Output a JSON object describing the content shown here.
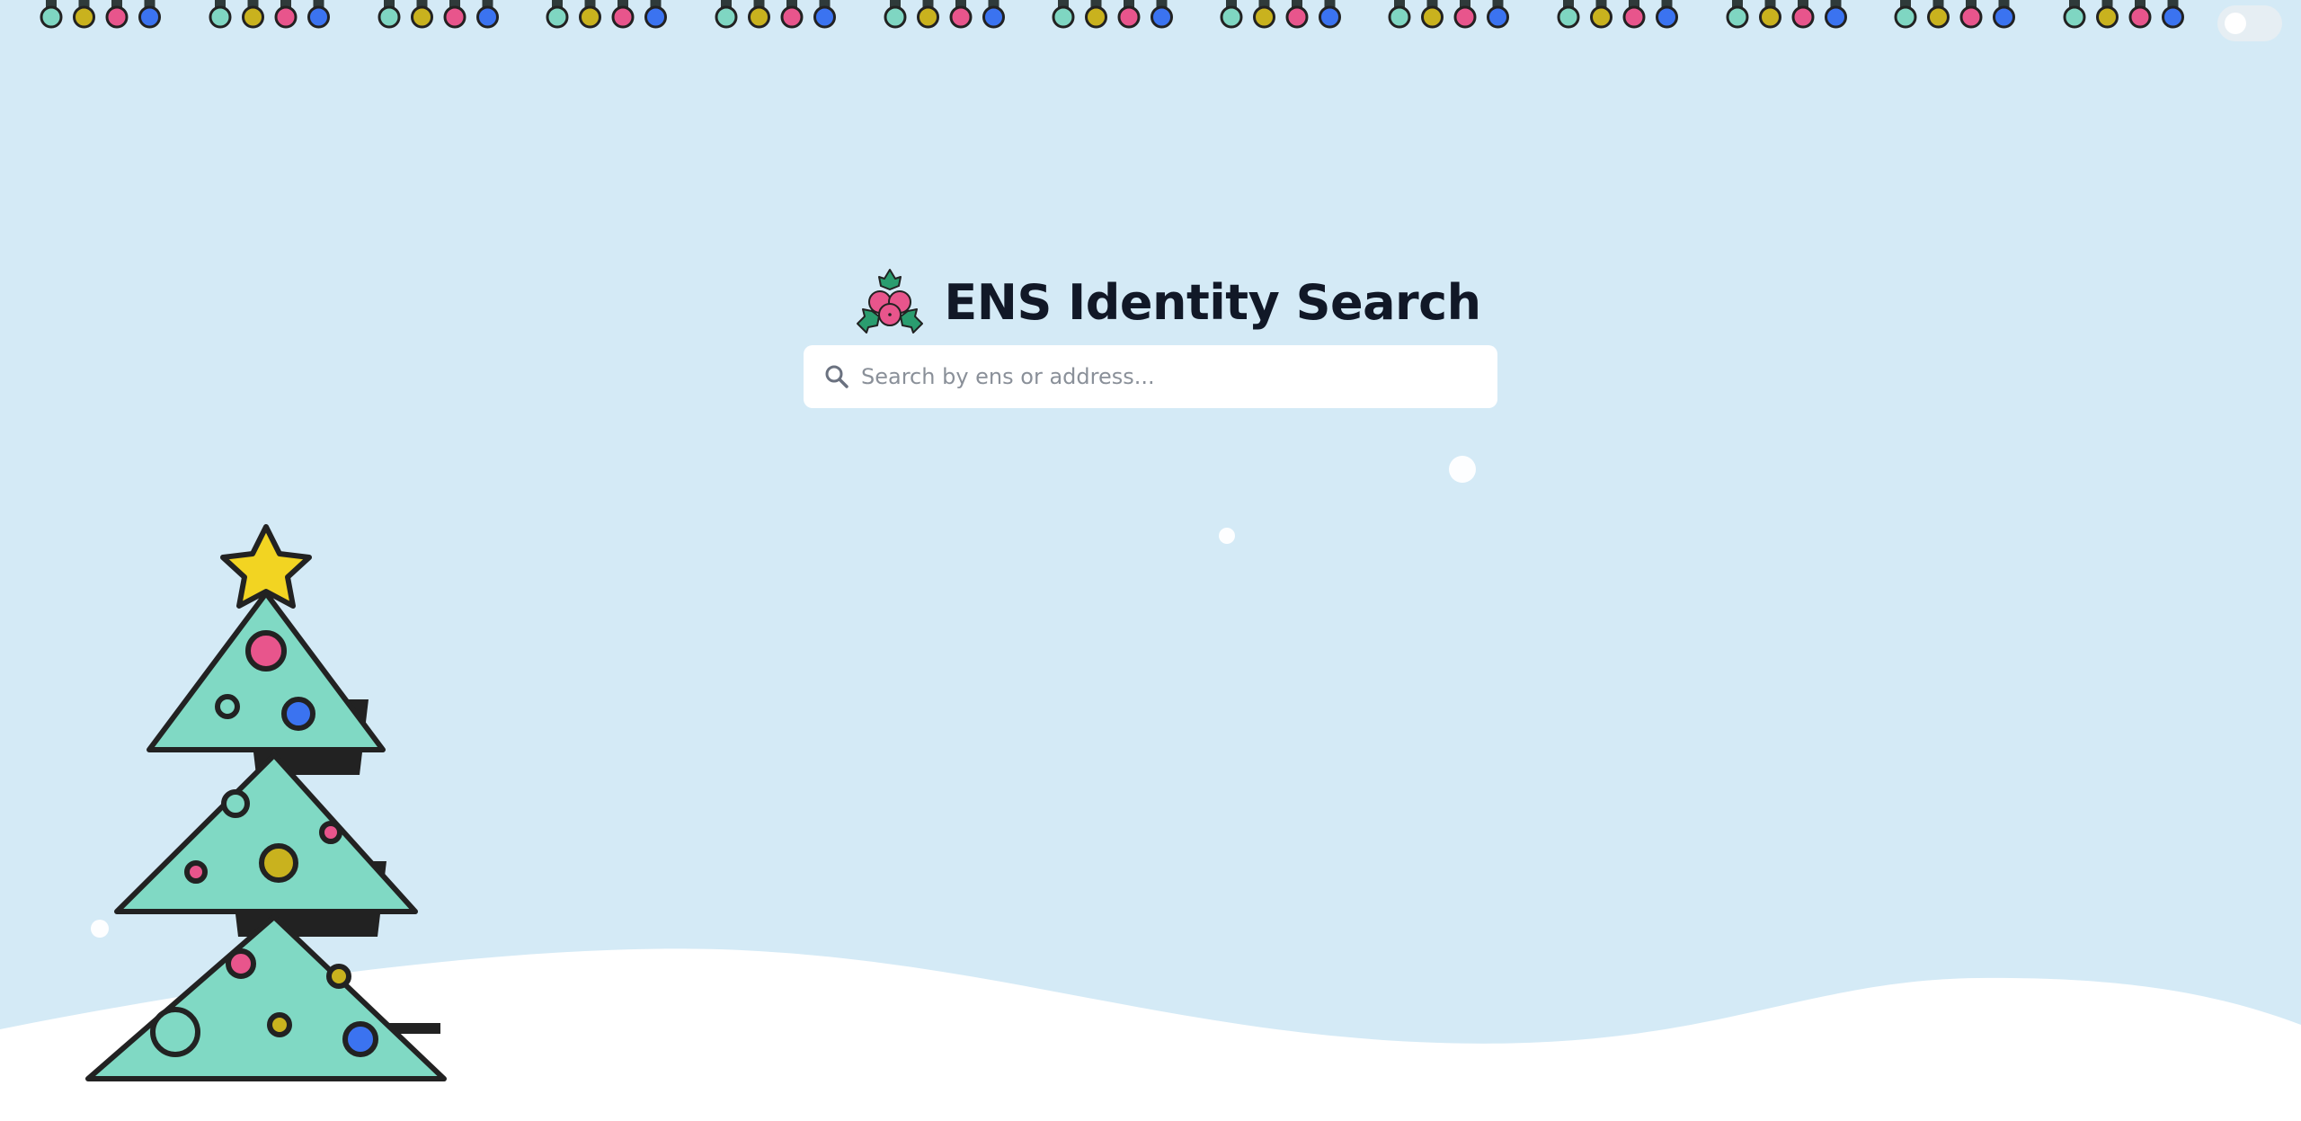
{
  "app": {
    "title": "ENS Identity Search"
  },
  "search": {
    "placeholder": "Search by ens or address...",
    "value": ""
  },
  "theme_toggle": {
    "state": "off"
  },
  "colors": {
    "background": "#d4eaf6",
    "snow": "#ffffff",
    "bulb_teal": "#7fd6c2",
    "bulb_yellow": "#c9b21e",
    "bulb_pink": "#e8558c",
    "bulb_blue": "#3b73f0",
    "tree_green": "#80d9c4",
    "star_yellow": "#f2d422",
    "holly_leaf": "#2a9d6f",
    "outline": "#222222"
  },
  "icons": {
    "search": "search-icon",
    "holly": "holly-icon",
    "tree": "christmas-tree",
    "lights": "string-lights"
  }
}
